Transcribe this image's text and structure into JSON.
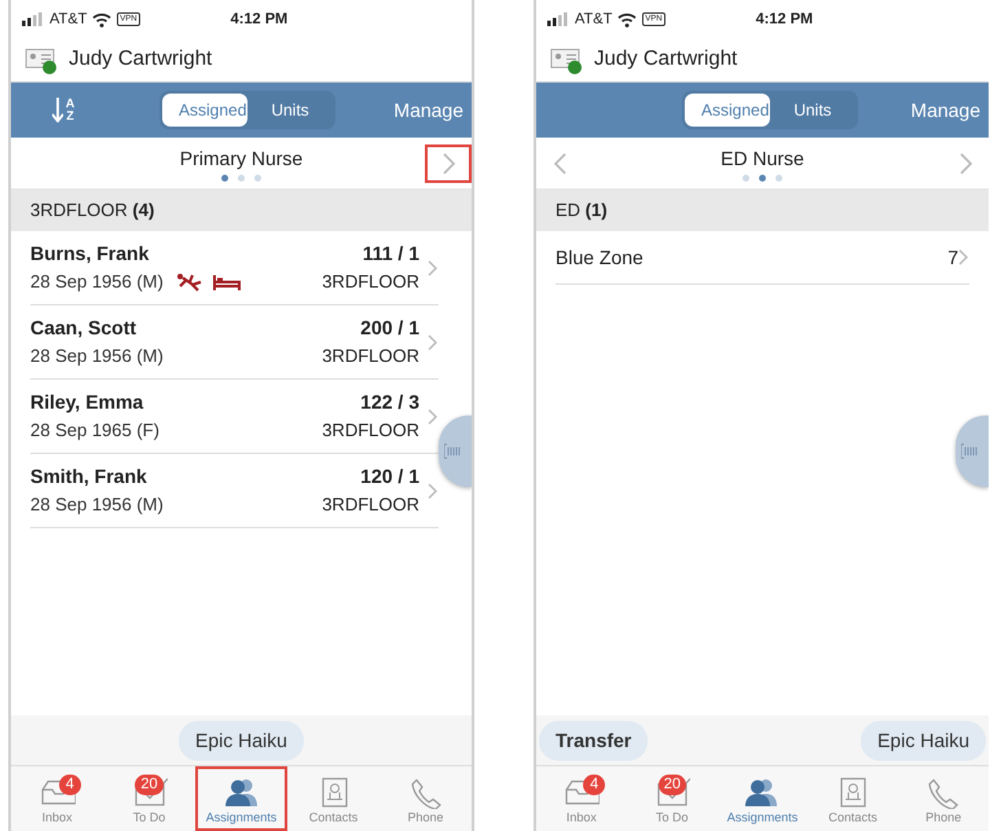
{
  "phones": [
    {
      "status": {
        "carrier": "AT&T",
        "vpn": "VPN",
        "time": "4:12 PM"
      },
      "user": {
        "name": "Judy Cartwright",
        "online": true
      },
      "sort": {
        "top": "A",
        "bottom": "Z"
      },
      "segments": [
        {
          "label": "Assigned",
          "selected": true
        },
        {
          "label": "Units",
          "selected": false
        }
      ],
      "manage": "Manage",
      "role": {
        "title": "Primary Nurse",
        "prev": false,
        "next": true,
        "next_highlighted": true,
        "pages": [
          {
            "selected": true
          },
          {
            "selected": false
          },
          {
            "selected": false
          }
        ]
      },
      "section": "3RDFLOOR **(4)**",
      "patients": [
        {
          "name": "Burns, Frank",
          "details": "28 Sep 1956 (M)",
          "flags": [
            {
              "kind": "fall"
            },
            {
              "kind": "bed"
            }
          ],
          "room": "111 / 1",
          "unit": "3RDFLOOR"
        },
        {
          "name": "Caan, Scott",
          "details": "28 Sep 1956 (M)",
          "room": "200 / 1",
          "unit": "3RDFLOOR"
        },
        {
          "name": "Riley, Emma",
          "details": "28 Sep 1965 (F)",
          "room": "122 / 3",
          "unit": "3RDFLOOR"
        },
        {
          "name": "Smith, Frank",
          "details": "28 Sep 1956 (M)",
          "room": "120 / 1",
          "unit": "3RDFLOOR"
        }
      ],
      "actions": [
        {
          "label": "Epic Haiku",
          "kind": "secondary"
        }
      ],
      "tabs": [
        {
          "kind": "inbox",
          "label": "Inbox",
          "badge": "4",
          "selected": false,
          "highlighted": false
        },
        {
          "kind": "todo",
          "label": "To Do",
          "badge": "20",
          "selected": false,
          "highlighted": false
        },
        {
          "kind": "people",
          "label": "Assignments",
          "selected": true,
          "highlighted": true
        },
        {
          "kind": "contacts",
          "label": "Contacts",
          "selected": false,
          "highlighted": false
        },
        {
          "kind": "phone",
          "label": "Phone",
          "selected": false,
          "highlighted": false
        }
      ]
    },
    {
      "status": {
        "carrier": "AT&T",
        "vpn": "VPN",
        "time": "4:12 PM"
      },
      "user": {
        "name": "Judy Cartwright",
        "online": true
      },
      "segments": [
        {
          "label": "Assigned",
          "selected": true
        },
        {
          "label": "Units",
          "selected": false
        }
      ],
      "manage": "Manage",
      "role": {
        "title": "ED Nurse",
        "prev": true,
        "next": true,
        "next_highlighted": false,
        "pages": [
          {
            "selected": false
          },
          {
            "selected": true
          },
          {
            "selected": false
          }
        ]
      },
      "section": "ED **(1)**",
      "units": [
        {
          "name": "Blue Zone",
          "count": "7"
        }
      ],
      "actions": [
        {
          "label": "Transfer",
          "kind": "primary"
        },
        {
          "label": "Epic Haiku",
          "kind": "secondary"
        }
      ],
      "tabs": [
        {
          "kind": "inbox",
          "label": "Inbox",
          "badge": "4",
          "selected": false,
          "highlighted": false
        },
        {
          "kind": "todo",
          "label": "To Do",
          "badge": "20",
          "selected": false,
          "highlighted": false
        },
        {
          "kind": "people",
          "label": "Assignments",
          "selected": true,
          "highlighted": false
        },
        {
          "kind": "contacts",
          "label": "Contacts",
          "selected": false,
          "highlighted": false
        },
        {
          "kind": "phone",
          "label": "Phone",
          "selected": false,
          "highlighted": false
        }
      ]
    }
  ]
}
